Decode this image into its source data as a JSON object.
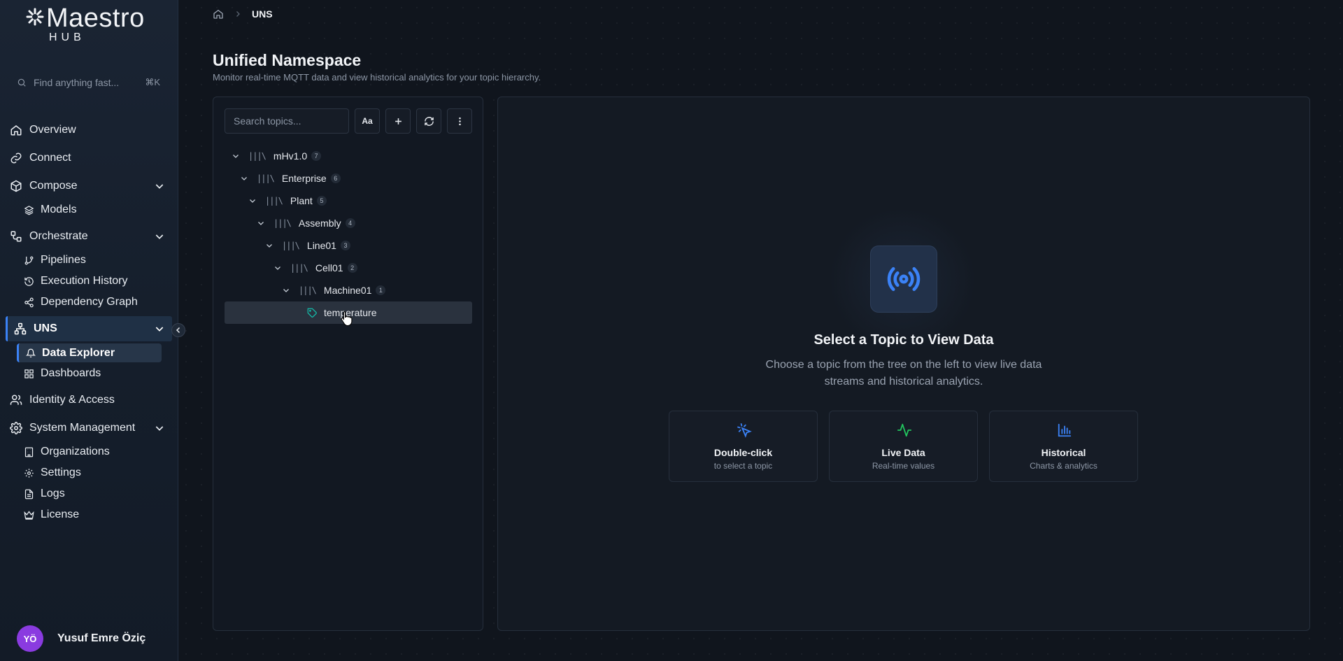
{
  "app": {
    "logo_text": "Maestro",
    "logo_sub": "HUB"
  },
  "sidebar": {
    "search_placeholder": "Find anything fast...",
    "search_shortcut": "⌘K",
    "items": {
      "overview": "Overview",
      "connect": "Connect",
      "compose": "Compose",
      "models": "Models",
      "orchestrate": "Orchestrate",
      "pipelines": "Pipelines",
      "execution_history": "Execution History",
      "dependency_graph": "Dependency Graph",
      "uns": "UNS",
      "data_explorer": "Data Explorer",
      "dashboards": "Dashboards",
      "identity_access": "Identity & Access",
      "system_management": "System Management",
      "organizations": "Organizations",
      "settings": "Settings",
      "logs": "Logs",
      "license": "License"
    },
    "user": {
      "initials": "YÖ",
      "name": "Yusuf Emre Öziç"
    }
  },
  "breadcrumb": {
    "current": "UNS"
  },
  "page": {
    "title": "Unified Namespace",
    "subtitle": "Monitor real-time MQTT data and view historical analytics for your topic hierarchy."
  },
  "topics": {
    "search_placeholder": "Search topics...",
    "case_button": "Aa",
    "tree": [
      {
        "label": "mHv1.0",
        "count": "7"
      },
      {
        "label": "Enterprise",
        "count": "6"
      },
      {
        "label": "Plant",
        "count": "5"
      },
      {
        "label": "Assembly",
        "count": "4"
      },
      {
        "label": "Line01",
        "count": "3"
      },
      {
        "label": "Cell01",
        "count": "2"
      },
      {
        "label": "Machine01",
        "count": "1"
      },
      {
        "label": "temperature"
      }
    ]
  },
  "empty_state": {
    "title": "Select a Topic to View Data",
    "description": "Choose a topic from the tree on the left to view live data streams and historical analytics.",
    "cards": [
      {
        "title": "Double-click",
        "subtitle": "to select a topic"
      },
      {
        "title": "Live Data",
        "subtitle": "Real-time values"
      },
      {
        "title": "Historical",
        "subtitle": "Charts & analytics"
      }
    ]
  },
  "colors": {
    "accent": "#3b82f6",
    "live_green": "#22c55e",
    "avatar": "#8a3be0",
    "tag_teal": "#14b8a6"
  }
}
